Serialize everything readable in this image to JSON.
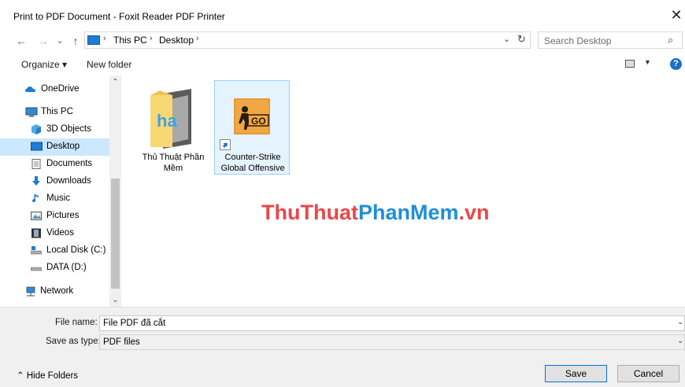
{
  "window": {
    "title": "Print to PDF Document - Foxit Reader PDF Printer",
    "close_glyph": "✕"
  },
  "nav": {
    "back_glyph": "←",
    "forward_glyph": "→",
    "recent_glyph": "⌄",
    "up_glyph": "↑",
    "breadcrumb": [
      "This PC",
      "Desktop"
    ],
    "search_placeholder": "Search Desktop"
  },
  "toolbar": {
    "organize_label": "Organize ▾",
    "new_folder_label": "New folder",
    "help_label": "?"
  },
  "sidebar": {
    "items": [
      {
        "label": "OneDrive",
        "icon": "onedrive-icon"
      },
      {
        "label": "This PC",
        "icon": "computer-icon"
      },
      {
        "label": "3D Objects",
        "icon": "cube-icon"
      },
      {
        "label": "Desktop",
        "icon": "desktop-icon",
        "selected": true
      },
      {
        "label": "Documents",
        "icon": "documents-icon"
      },
      {
        "label": "Downloads",
        "icon": "download-arrow-icon"
      },
      {
        "label": "Music",
        "icon": "music-note-icon"
      },
      {
        "label": "Pictures",
        "icon": "pictures-icon"
      },
      {
        "label": "Videos",
        "icon": "film-icon"
      },
      {
        "label": "Local Disk (C:)",
        "icon": "drive-icon"
      },
      {
        "label": "DATA (D:)",
        "icon": "drive-icon"
      },
      {
        "label": "Network",
        "icon": "network-icon"
      }
    ]
  },
  "files": [
    {
      "label": "Thủ Thuật Phần Mềm",
      "icon": "folder-icon"
    },
    {
      "label": "Counter-Strike Global Offensive",
      "icon": "game-shortcut-icon",
      "selected": true
    }
  ],
  "watermark": {
    "part1": "ThuThuat",
    "part2": "PhanMem",
    "part3": ".vn"
  },
  "footer": {
    "file_name_label": "File name:",
    "file_name_value": "File PDF đã cắt",
    "save_type_label": "Save as type:",
    "save_type_value": "PDF files",
    "hide_folders_label": "⌃  Hide Folders",
    "save_label": "Save",
    "cancel_label": "Cancel"
  },
  "colors": {
    "accent": "#0078d7",
    "selection": "#cce8ff",
    "watermark_red": "#e8474a",
    "watermark_blue": "#1e8fd8"
  }
}
